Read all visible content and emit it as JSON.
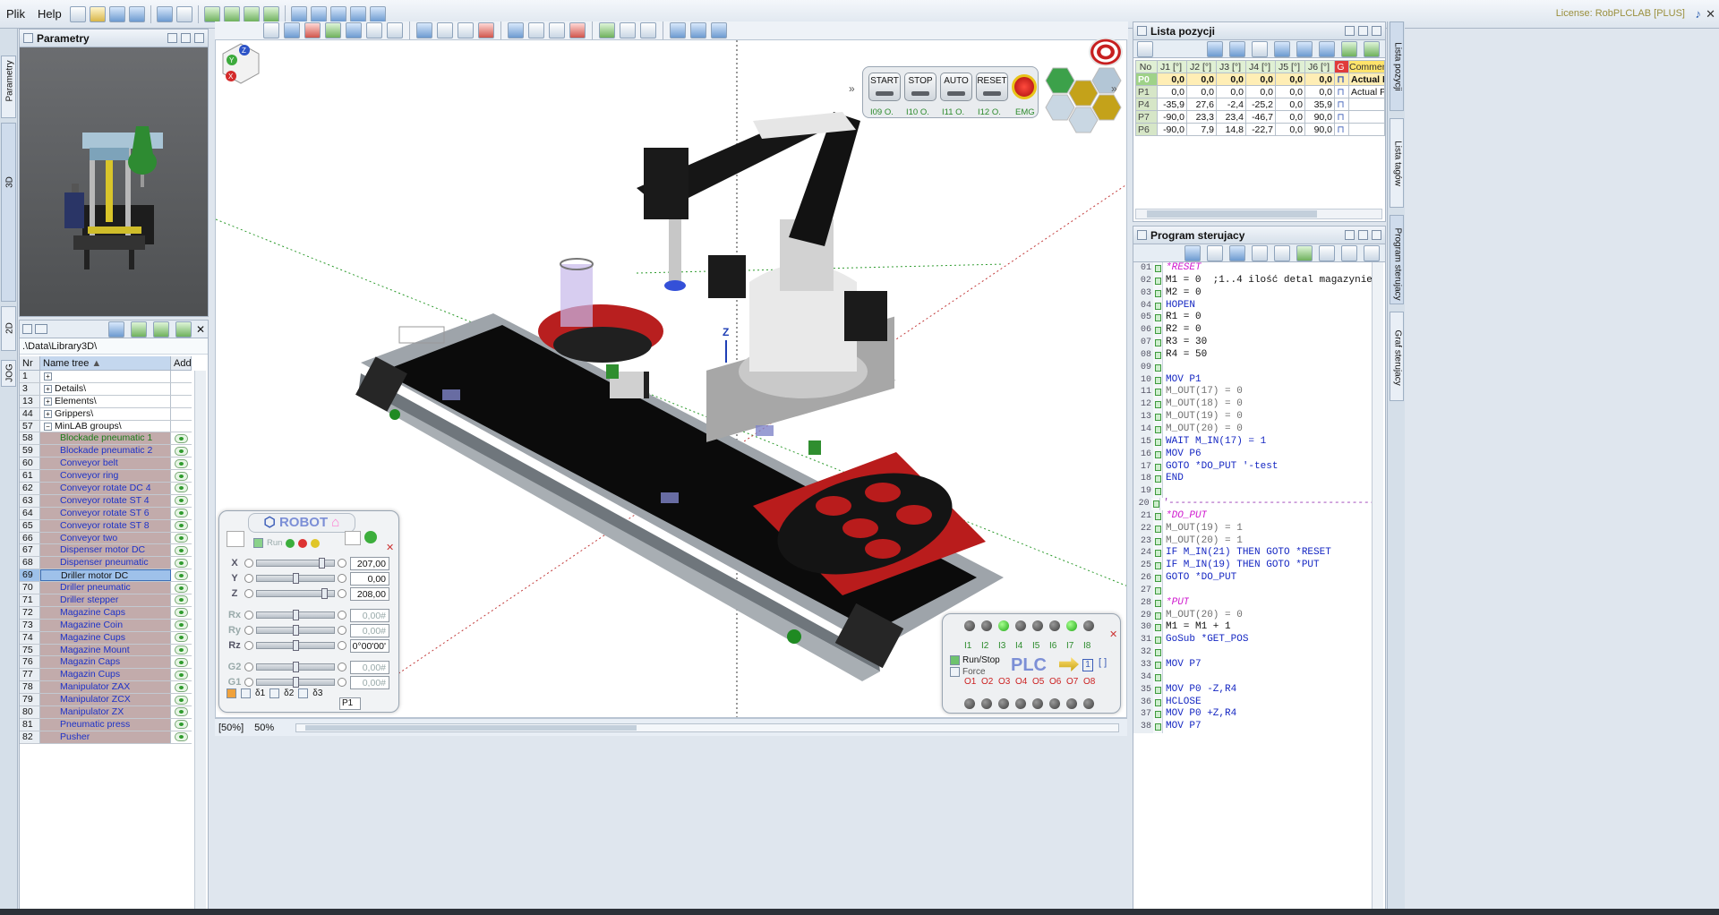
{
  "menu": {
    "file": "Plik",
    "help": "Help"
  },
  "license": "License: RobPLCLAB [PLUS]",
  "left_tabs": [
    "Parametry",
    "3D",
    "2D",
    "JOG"
  ],
  "param_panel": {
    "title": "Parametry"
  },
  "library": {
    "path": ".\\Data\\Library3D\\",
    "headers": {
      "nr": "Nr",
      "name": "Name tree",
      "add": "Add"
    },
    "rows": [
      {
        "nr": "1",
        "name": "",
        "type": "folder"
      },
      {
        "nr": "3",
        "name": "Details\\",
        "type": "folder"
      },
      {
        "nr": "13",
        "name": "Elements\\",
        "type": "folder"
      },
      {
        "nr": "44",
        "name": "Grippers\\",
        "type": "folder"
      },
      {
        "nr": "57",
        "name": "MinLAB groups\\",
        "type": "folder-open"
      },
      {
        "nr": "58",
        "name": "Blockade pneumatic 1",
        "type": "item-green"
      },
      {
        "nr": "59",
        "name": "Blockade pneumatic 2",
        "type": "item"
      },
      {
        "nr": "60",
        "name": "Conveyor belt",
        "type": "item"
      },
      {
        "nr": "61",
        "name": "Conveyor ring",
        "type": "item"
      },
      {
        "nr": "62",
        "name": "Conveyor rotate DC 4",
        "type": "item"
      },
      {
        "nr": "63",
        "name": "Conveyor rotate ST 4",
        "type": "item"
      },
      {
        "nr": "64",
        "name": "Conveyor rotate ST 6",
        "type": "item"
      },
      {
        "nr": "65",
        "name": "Conveyor rotate ST 8",
        "type": "item"
      },
      {
        "nr": "66",
        "name": "Conveyor two",
        "type": "item"
      },
      {
        "nr": "67",
        "name": "Dispenser motor DC",
        "type": "item"
      },
      {
        "nr": "68",
        "name": "Dispenser pneumatic",
        "type": "item"
      },
      {
        "nr": "69",
        "name": "Driller motor DC",
        "type": "selected"
      },
      {
        "nr": "70",
        "name": "Driller pneumatic",
        "type": "item"
      },
      {
        "nr": "71",
        "name": "Driller stepper",
        "type": "item"
      },
      {
        "nr": "72",
        "name": "Magazine Caps",
        "type": "item"
      },
      {
        "nr": "73",
        "name": "Magazine Coin",
        "type": "item"
      },
      {
        "nr": "74",
        "name": "Magazine Cups",
        "type": "item"
      },
      {
        "nr": "75",
        "name": "Magazine Mount",
        "type": "item"
      },
      {
        "nr": "76",
        "name": "Magazin Caps",
        "type": "item"
      },
      {
        "nr": "77",
        "name": "Magazin Cups",
        "type": "item"
      },
      {
        "nr": "78",
        "name": "Manipulator ZAX",
        "type": "item"
      },
      {
        "nr": "79",
        "name": "Manipulator ZCX",
        "type": "item"
      },
      {
        "nr": "80",
        "name": "Manipulator ZX",
        "type": "item"
      },
      {
        "nr": "81",
        "name": "Pneumatic press",
        "type": "item"
      },
      {
        "nr": "82",
        "name": "Pusher",
        "type": "item"
      }
    ]
  },
  "control": {
    "start": "START",
    "stop": "STOP",
    "auto": "AUTO",
    "reset": "RESET",
    "io": [
      "I09 O.",
      "I10 O.",
      "I11 O.",
      "I12 O.",
      "EMG"
    ]
  },
  "robot": {
    "title": "ROBOT",
    "run": "Run",
    "axes": [
      {
        "label": "X",
        "value": "207,00",
        "pos": 0.86,
        "enabled": true
      },
      {
        "label": "Y",
        "value": "0,00",
        "pos": 0.5,
        "enabled": true
      },
      {
        "label": "Z",
        "value": "208,00",
        "pos": 0.9,
        "enabled": true
      },
      {
        "label": "Rx",
        "value": "0,00#",
        "pos": 0.5,
        "enabled": false
      },
      {
        "label": "Ry",
        "value": "0,00#",
        "pos": 0.5,
        "enabled": false
      },
      {
        "label": "Rz",
        "value": "0°00'00'",
        "pos": 0.5,
        "enabled": true
      },
      {
        "label": "G2",
        "value": "0,00#",
        "pos": 0.5,
        "enabled": false
      },
      {
        "label": "G1",
        "value": "0,00#",
        "pos": 0.5,
        "enabled": false
      }
    ],
    "checks": [
      "δ1",
      "δ2",
      "δ3"
    ],
    "position_field": "P1"
  },
  "plc": {
    "title": "PLC",
    "inputs": [
      "I1",
      "I2",
      "I3",
      "I4",
      "I5",
      "I6",
      "I7",
      "I8"
    ],
    "outputs": [
      "O1",
      "O2",
      "O3",
      "O4",
      "O5",
      "O6",
      "O7",
      "O8"
    ],
    "input_leds": [
      false,
      false,
      true,
      false,
      false,
      false,
      true,
      false
    ],
    "run_stop": "Run/Stop",
    "force": "Force",
    "counter": "1"
  },
  "viewport": {
    "axis_label": "Z",
    "zoom1": "[50%]",
    "zoom2": "50%"
  },
  "positions": {
    "title": "Lista pozycji",
    "headers": [
      "No",
      "J1 [°]",
      "J2 [°]",
      "J3 [°]",
      "J4 [°]",
      "J5 [°]",
      "J6 [°]",
      "G",
      "Comment"
    ],
    "rows": [
      {
        "no": "P0",
        "vals": [
          "0,0",
          "0,0",
          "0,0",
          "0,0",
          "0,0",
          "0,0"
        ],
        "comment": "Actual P",
        "selected": true
      },
      {
        "no": "P1",
        "vals": [
          "0,0",
          "0,0",
          "0,0",
          "0,0",
          "0,0",
          "0,0"
        ],
        "comment": "Actual PO",
        "selected": false
      },
      {
        "no": "P4",
        "vals": [
          "-35,9",
          "27,6",
          "-2,4",
          "-25,2",
          "0,0",
          "35,9"
        ],
        "comment": "",
        "selected": false
      },
      {
        "no": "P7",
        "vals": [
          "-90,0",
          "23,3",
          "23,4",
          "-46,7",
          "0,0",
          "90,0"
        ],
        "comment": "",
        "selected": false
      },
      {
        "no": "P6",
        "vals": [
          "-90,0",
          "7,9",
          "14,8",
          "-22,7",
          "0,0",
          "90,0"
        ],
        "comment": "",
        "selected": false
      }
    ]
  },
  "program": {
    "title": "Program sterujacy",
    "lines": [
      "*RESET",
      "M1 = 0  ;1..4 ilość detal magazynie",
      "M2 = 0",
      "HOPEN",
      "R1 = 0",
      "R2 = 0",
      "R3 = 30",
      "R4 = 50",
      "",
      "MOV P1",
      "M_OUT(17) = 0",
      "M_OUT(18) = 0",
      "M_OUT(19) = 0",
      "M_OUT(20) = 0",
      "WAIT M_IN(17) = 1",
      "MOV P6",
      "GOTO *DO_PUT '-test",
      "END",
      "",
      "'---------------------------------------",
      "*DO_PUT",
      "M_OUT(19) = 1",
      "M_OUT(20) = 1",
      "IF M_IN(21) THEN GOTO *RESET",
      "IF M_IN(19) THEN GOTO *PUT",
      "GOTO *DO_PUT",
      "",
      "*PUT",
      "M_OUT(20) = 0",
      "M1 = M1 + 1",
      "GoSub *GET_POS",
      "",
      "MOV P7",
      "",
      "MOV P0 -Z,R4",
      "HCLOSE",
      "MOV P0 +Z,R4",
      "MOV P7"
    ]
  },
  "right_tabs": [
    "Lista pozycji",
    "Lista tagów",
    "Program sterujacy",
    "Graf sterujacy"
  ]
}
